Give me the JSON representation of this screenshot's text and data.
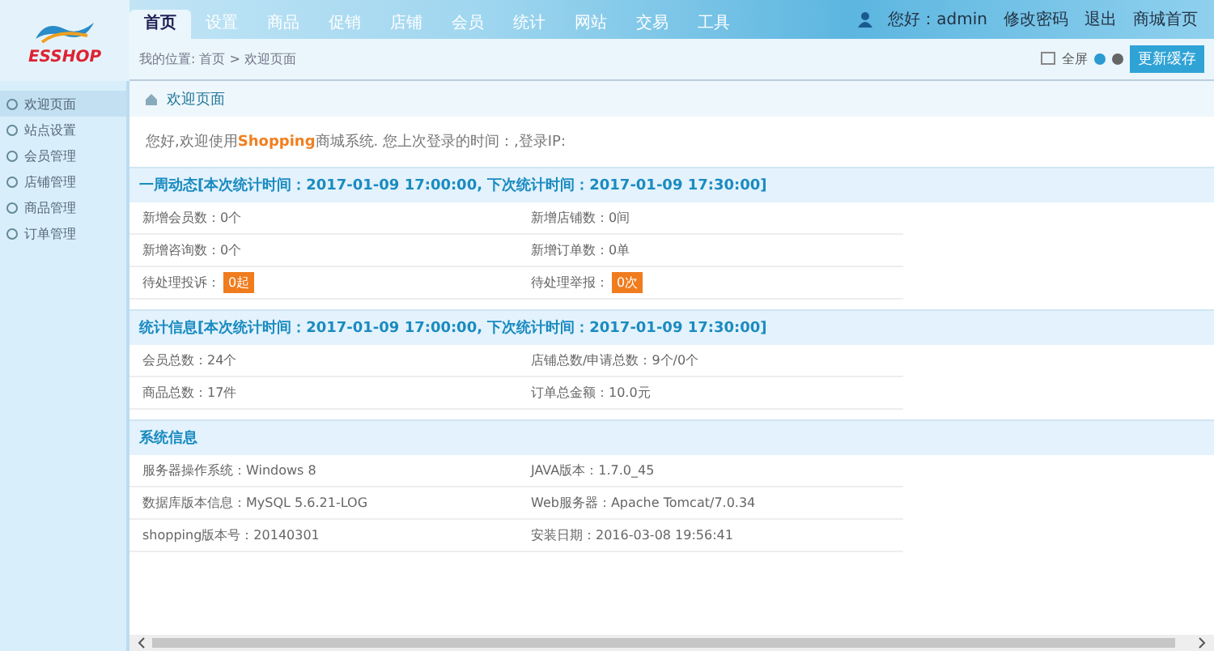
{
  "logo": {
    "text": "ESSHOP"
  },
  "nav": [
    {
      "label": "首页",
      "selected": true
    },
    {
      "label": "设置",
      "selected": false
    },
    {
      "label": "商品",
      "selected": false
    },
    {
      "label": "促销",
      "selected": false
    },
    {
      "label": "店铺",
      "selected": false
    },
    {
      "label": "会员",
      "selected": false
    },
    {
      "label": "统计",
      "selected": false
    },
    {
      "label": "网站",
      "selected": false
    },
    {
      "label": "交易",
      "selected": false
    },
    {
      "label": "工具",
      "selected": false
    }
  ],
  "user_bar": {
    "greeting": "您好：admin",
    "links": [
      "修改密码",
      "退出",
      "商城首页"
    ]
  },
  "breadcrumb": "我的位置: 首页 > 欢迎页面",
  "toolbar": {
    "fullscreen": "全屏",
    "button": "更新缓存"
  },
  "sidebar": {
    "items": [
      {
        "label": "欢迎页面",
        "selected": true
      },
      {
        "label": "站点设置",
        "selected": false
      },
      {
        "label": "会员管理",
        "selected": false
      },
      {
        "label": "店铺管理",
        "selected": false
      },
      {
        "label": "商品管理",
        "selected": false
      },
      {
        "label": "订单管理",
        "selected": false
      }
    ]
  },
  "panel_title": "欢迎页面",
  "welcome": "您好,欢迎使用**Shopping**商城系统. 您上次登录的时间：,登录IP:",
  "sections": [
    {
      "title": "一周动态[本次统计时间：2017-01-09 17:00:00, 下次统计时间：2017-01-09 17:30:00]",
      "rows": [
        [
          {
            "label": "新增会员数：",
            "value": "0个"
          },
          {
            "label": "新增店铺数：",
            "value": "0间"
          }
        ],
        [
          {
            "label": "新增咨询数：",
            "value": "0个"
          },
          {
            "label": "新增订单数：",
            "value": "0单"
          }
        ],
        [
          {
            "label": "待处理投诉：",
            "value": "0起",
            "kind": "badge"
          },
          {
            "label": "待处理举报：",
            "value": "0次",
            "kind": "badge"
          }
        ]
      ]
    },
    {
      "title": "统计信息[本次统计时间：2017-01-09 17:00:00, 下次统计时间：2017-01-09 17:30:00]",
      "rows": [
        [
          {
            "label": "会员总数：",
            "value": "24个"
          },
          {
            "label": "店铺总数/申请总数：",
            "value": "9个/0个"
          }
        ],
        [
          {
            "label": "商品总数：",
            "value": "17件"
          },
          {
            "label": "订单总金额：",
            "value": "10.0元"
          }
        ]
      ]
    },
    {
      "title": "系统信息",
      "rows": [
        [
          {
            "label": "服务器操作系统：",
            "value": "Windows 8"
          },
          {
            "label": "JAVA版本：",
            "value": "1.7.0_45"
          }
        ],
        [
          {
            "label": "数据库版本信息：",
            "value": "MySQL 5.6.21-LOG"
          },
          {
            "label": "Web服务器：",
            "value": "Apache Tomcat/7.0.34"
          }
        ],
        [
          {
            "label": "shopping版本号：",
            "value": "20140301"
          },
          {
            "label": "安装日期：",
            "value": "2016-03-08 19:56:41"
          }
        ]
      ]
    }
  ]
}
